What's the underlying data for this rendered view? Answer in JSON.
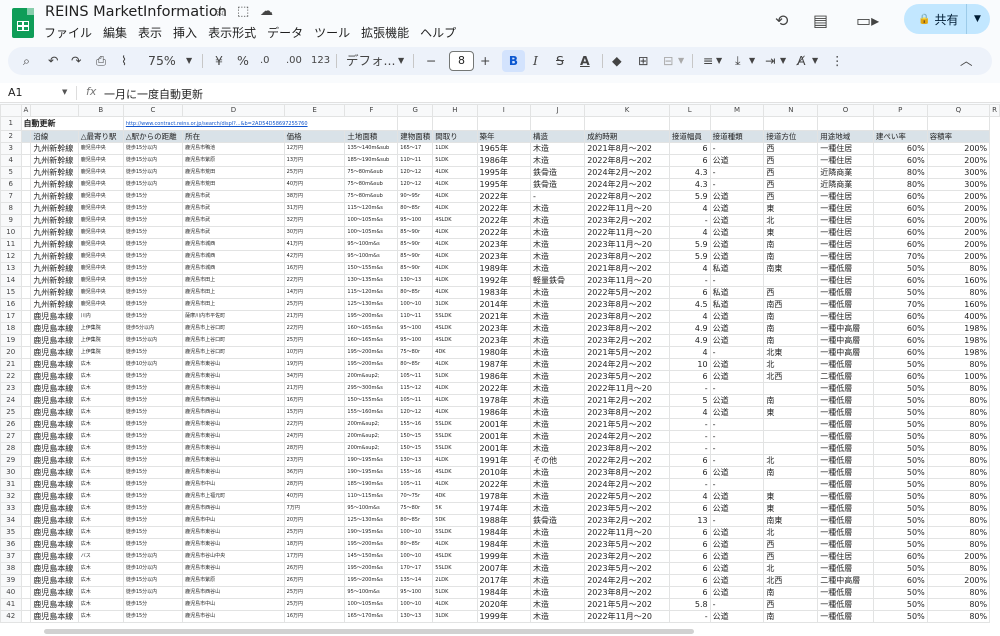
{
  "app": {
    "title": "REINS MarketInformation",
    "share_label": "共有"
  },
  "menu": [
    "ファイル",
    "編集",
    "表示",
    "挿入",
    "表示形式",
    "データ",
    "ツール",
    "拡張機能",
    "ヘルプ"
  ],
  "toolbar": {
    "zoom": "75%",
    "currency": "¥",
    "percent": "%",
    "dec_decrease": ".0",
    "dec_increase": ".00",
    "number_format": "123",
    "font": "デフォ...",
    "font_size": "8"
  },
  "formula_bar": {
    "cell": "A1",
    "fx": "fx",
    "content": "一月に一度自動更新"
  },
  "columns": [
    "",
    "A",
    "B",
    "C",
    "D",
    "E",
    "F",
    "G",
    "H",
    "I",
    "J",
    "K",
    "L",
    "M",
    "N",
    "O",
    "P",
    "Q",
    "R"
  ],
  "row1": {
    "a": "自動更新",
    "url": "http://www.contract.reins.or.jp/search/displ?...&b=2AD54D58697255760"
  },
  "headers": [
    "",
    "沿線",
    "△最寄り駅",
    "△駅からの距離",
    "所在",
    "価格",
    "土地面積",
    "建物面積",
    "間取り",
    "築年",
    "構造",
    "成約時期",
    "接道幅員",
    "接道種類",
    "接道方位",
    "用途地域",
    "建ぺい率",
    "容積率"
  ],
  "rows": [
    [
      "九州新幹線",
      "鹿児島中央",
      "徒歩15分以内",
      "鹿児島市鴨池",
      "12万円",
      "135〜140m&sub",
      "165〜17",
      "1LDK",
      "1965年",
      "木造",
      "2021年8月〜202",
      "6",
      "-",
      "西",
      "一種住居",
      "60%",
      "200%"
    ],
    [
      "九州新幹線",
      "鹿児島中央",
      "徒歩15分以内",
      "鹿児島市紫原",
      "13万円",
      "185〜190m&sub",
      "110〜11",
      "5LDK",
      "1986年",
      "木造",
      "2022年8月〜202",
      "6",
      "公道",
      "西",
      "一種住居",
      "60%",
      "200%"
    ],
    [
      "九州新幹線",
      "鹿児島中央",
      "徒歩15分以内",
      "鹿児島市荒田",
      "25万円",
      "75〜80m&sub",
      "120〜12",
      "4LDK",
      "1995年",
      "鉄骨造",
      "2024年2月〜202",
      "4.3",
      "-",
      "西",
      "近隣商業",
      "80%",
      "300%"
    ],
    [
      "九州新幹線",
      "鹿児島中央",
      "徒歩15分以内",
      "鹿児島市荒田",
      "40万円",
      "75〜80m&sub",
      "120〜12",
      "4LDK",
      "1995年",
      "鉄骨造",
      "2024年2月〜202",
      "4.3",
      "-",
      "西",
      "近隣商業",
      "80%",
      "300%"
    ],
    [
      "九州新幹線",
      "鹿児島中央",
      "徒歩15分",
      "鹿児島市武",
      "38万円",
      "75〜80m&sub",
      "90〜95r",
      "4LDK",
      "2022年",
      "-",
      "2022年8月〜202",
      "5.9",
      "公道",
      "西",
      "一種住居",
      "60%",
      "200%"
    ],
    [
      "九州新幹線",
      "鹿児島中央",
      "徒歩15分",
      "鹿児島市武",
      "31万円",
      "115〜120m&s",
      "80〜85r",
      "4LDK",
      "2022年",
      "木造",
      "2022年11月〜20",
      "4",
      "公道",
      "東",
      "一種住居",
      "60%",
      "200%"
    ],
    [
      "九州新幹線",
      "鹿児島中央",
      "徒歩15分",
      "鹿児島市武",
      "32万円",
      "100〜105m&s",
      "95〜100",
      "4SLDK",
      "2022年",
      "木造",
      "2023年2月〜202",
      "-",
      "公道",
      "北",
      "一種住居",
      "60%",
      "200%"
    ],
    [
      "九州新幹線",
      "鹿児島中央",
      "徒歩15分",
      "鹿児島市武",
      "30万円",
      "100〜105m&s",
      "85〜90r",
      "4LDK",
      "2022年",
      "木造",
      "2022年11月〜20",
      "4",
      "公道",
      "東",
      "一種住居",
      "60%",
      "200%"
    ],
    [
      "九州新幹線",
      "鹿児島中央",
      "徒歩15分",
      "鹿児島市城西",
      "41万円",
      "95〜100m&s",
      "85〜90r",
      "4LDK",
      "2023年",
      "木造",
      "2023年11月〜20",
      "5.9",
      "公道",
      "南",
      "一種住居",
      "60%",
      "200%"
    ],
    [
      "九州新幹線",
      "鹿児島中央",
      "徒歩15分",
      "鹿児島市城西",
      "42万円",
      "95〜100m&s",
      "85〜90r",
      "4LDK",
      "2023年",
      "木造",
      "2023年8月〜202",
      "5.9",
      "公道",
      "南",
      "一種住居",
      "70%",
      "200%"
    ],
    [
      "九州新幹線",
      "鹿児島中央",
      "徒歩15分",
      "鹿児島市城西",
      "16万円",
      "150〜155m&s",
      "85〜90r",
      "4LDK",
      "1989年",
      "木造",
      "2021年8月〜202",
      "4",
      "私道",
      "南東",
      "一種低層",
      "50%",
      "80%"
    ],
    [
      "九州新幹線",
      "鹿児島中央",
      "徒歩15分",
      "鹿児島市田上",
      "22万円",
      "130〜135m&s",
      "130〜13",
      "4LDK",
      "1992年",
      "軽量鉄骨",
      "2023年11月〜20",
      "-",
      "-",
      "",
      "一種住居",
      "60%",
      "160%"
    ],
    [
      "九州新幹線",
      "鹿児島中央",
      "徒歩15分",
      "鹿児島市田上",
      "14万円",
      "115〜120m&s",
      "80〜85r",
      "4LDK",
      "1983年",
      "木造",
      "2022年5月〜202",
      "6",
      "私道",
      "西",
      "一種低層",
      "50%",
      "80%"
    ],
    [
      "九州新幹線",
      "鹿児島中央",
      "徒歩15分",
      "鹿児島市田上",
      "25万円",
      "125〜130m&s",
      "100〜10",
      "3LDK",
      "2014年",
      "木造",
      "2023年8月〜202",
      "4.5",
      "私道",
      "南西",
      "一種低層",
      "70%",
      "160%"
    ],
    [
      "鹿児島本線",
      "川内",
      "徒歩15分",
      "薩摩川内市平佐町",
      "21万円",
      "195〜200m&s",
      "110〜11",
      "5SLDK",
      "2021年",
      "木造",
      "2023年8月〜202",
      "4",
      "公道",
      "南",
      "一種住居",
      "60%",
      "400%"
    ],
    [
      "鹿児島本線",
      "上伊集院",
      "徒歩5分以内",
      "鹿児島市上谷口町",
      "22万円",
      "160〜165m&s",
      "95〜100",
      "4SLDK",
      "2023年",
      "木造",
      "2023年8月〜202",
      "4.9",
      "公道",
      "南",
      "一種中高層",
      "60%",
      "198%"
    ],
    [
      "鹿児島本線",
      "上伊集院",
      "徒歩15分以内",
      "鹿児島市上谷口町",
      "25万円",
      "160〜165m&s",
      "95〜100",
      "4SLDK",
      "2023年",
      "木造",
      "2023年2月〜202",
      "4.9",
      "公道",
      "南",
      "一種中高層",
      "60%",
      "198%"
    ],
    [
      "鹿児島本線",
      "上伊集院",
      "徒歩15分",
      "鹿児島市上谷口町",
      "10万円",
      "195〜200m&s",
      "75〜80r",
      "4DK",
      "1980年",
      "木造",
      "2021年5月〜202",
      "4",
      "-",
      "北東",
      "一種中高層",
      "60%",
      "198%"
    ],
    [
      "鹿児島本線",
      "広木",
      "徒歩10分以内",
      "鹿児島市東谷山",
      "19万円",
      "195〜200m&s",
      "80〜85r",
      "4LDK",
      "1987年",
      "木造",
      "2024年2月〜202",
      "10",
      "公道",
      "北",
      "一種低層",
      "50%",
      "80%"
    ],
    [
      "鹿児島本線",
      "広木",
      "徒歩15分",
      "鹿児島市東谷山",
      "34万円",
      "200m&sup2;",
      "105〜11",
      "5LDK",
      "1986年",
      "木造",
      "2023年5月〜202",
      "6",
      "公道",
      "北西",
      "二種低層",
      "60%",
      "100%"
    ],
    [
      "鹿児島本線",
      "広木",
      "徒歩15分",
      "鹿児島市東谷山",
      "21万円",
      "295〜300m&s",
      "115〜12",
      "4LDK",
      "2022年",
      "木造",
      "2022年11月〜20",
      "-",
      "-",
      "",
      "一種低層",
      "50%",
      "80%"
    ],
    [
      "鹿児島本線",
      "広木",
      "徒歩15分",
      "鹿児島市西谷山",
      "16万円",
      "150〜155m&s",
      "105〜11",
      "4LDK",
      "1978年",
      "木造",
      "2021年2月〜202",
      "5",
      "公道",
      "南",
      "一種低層",
      "50%",
      "80%"
    ],
    [
      "鹿児島本線",
      "広木",
      "徒歩15分",
      "鹿児島市西谷山",
      "15万円",
      "155〜160m&s",
      "120〜12",
      "4LDK",
      "1986年",
      "木造",
      "2023年8月〜202",
      "4",
      "公道",
      "東",
      "一種低層",
      "50%",
      "80%"
    ],
    [
      "鹿児島本線",
      "広木",
      "徒歩15分",
      "鹿児島市東谷山",
      "22万円",
      "200m&sup2;",
      "155〜16",
      "5SLDK",
      "2001年",
      "木造",
      "2021年5月〜202",
      "-",
      "-",
      "",
      "一種低層",
      "50%",
      "80%"
    ],
    [
      "鹿児島本線",
      "広木",
      "徒歩15分",
      "鹿児島市東谷山",
      "24万円",
      "200m&sup2;",
      "150〜15",
      "5SLDK",
      "2001年",
      "木造",
      "2024年2月〜202",
      "-",
      "-",
      "",
      "一種低層",
      "50%",
      "80%"
    ],
    [
      "鹿児島本線",
      "広木",
      "徒歩15分",
      "鹿児島市東谷山",
      "28万円",
      "200m&sup2;",
      "150〜15",
      "5SLDK",
      "2001年",
      "木造",
      "2023年8月〜202",
      "-",
      "-",
      "",
      "一種低層",
      "50%",
      "80%"
    ],
    [
      "鹿児島本線",
      "広木",
      "徒歩15分",
      "鹿児島市東谷山",
      "23万円",
      "190〜195m&s",
      "130〜13",
      "4LDK",
      "1991年",
      "その他",
      "2022年2月〜202",
      "6",
      "-",
      "北",
      "一種低層",
      "50%",
      "80%"
    ],
    [
      "鹿児島本線",
      "広木",
      "徒歩15分",
      "鹿児島市東谷山",
      "36万円",
      "190〜195m&s",
      "155〜16",
      "4SLDK",
      "2010年",
      "木造",
      "2023年8月〜202",
      "6",
      "公道",
      "南",
      "一種低層",
      "50%",
      "80%"
    ],
    [
      "鹿児島本線",
      "広木",
      "徒歩15分",
      "鹿児島市中山",
      "28万円",
      "185〜190m&s",
      "105〜11",
      "4LDK",
      "2022年",
      "木造",
      "2024年2月〜202",
      "-",
      "-",
      "",
      "一種低層",
      "50%",
      "80%"
    ],
    [
      "鹿児島本線",
      "広木",
      "徒歩15分",
      "鹿児島市上福元町",
      "40万円",
      "110〜115m&s",
      "70〜75r",
      "4DK",
      "1978年",
      "木造",
      "2022年5月〜202",
      "4",
      "公道",
      "東",
      "一種低層",
      "50%",
      "80%"
    ],
    [
      "鹿児島本線",
      "広木",
      "徒歩15分",
      "鹿児島市西谷山",
      "7万円",
      "95〜100m&s",
      "75〜80r",
      "5K",
      "1974年",
      "木造",
      "2023年5月〜202",
      "6",
      "公道",
      "東",
      "一種低層",
      "50%",
      "80%"
    ],
    [
      "鹿児島本線",
      "広木",
      "徒歩15分",
      "鹿児島市中山",
      "20万円",
      "125〜130m&s",
      "80〜85r",
      "5DK",
      "1988年",
      "鉄骨造",
      "2023年2月〜202",
      "13",
      "-",
      "南東",
      "一種低層",
      "50%",
      "80%"
    ],
    [
      "鹿児島本線",
      "広木",
      "徒歩15分",
      "鹿児島市東谷山",
      "25万円",
      "190〜195m&s",
      "100〜10",
      "5SLDK",
      "1984年",
      "木造",
      "2022年11月〜20",
      "6",
      "公道",
      "北",
      "一種低層",
      "50%",
      "80%"
    ],
    [
      "鹿児島本線",
      "広木",
      "徒歩15分",
      "鹿児島市東谷山",
      "18万円",
      "195〜200m&s",
      "80〜85r",
      "4LDK",
      "1984年",
      "木造",
      "2023年5月〜202",
      "6",
      "公道",
      "西",
      "一種低層",
      "50%",
      "80%"
    ],
    [
      "鹿児島本線",
      "バス",
      "徒歩15分以内",
      "鹿児島市谷山中央",
      "17万円",
      "145〜150m&s",
      "100〜10",
      "4SLDK",
      "1999年",
      "木造",
      "2023年2月〜202",
      "6",
      "公道",
      "西",
      "一種住居",
      "60%",
      "200%"
    ],
    [
      "鹿児島本線",
      "広木",
      "徒歩10分以内",
      "鹿児島市東谷山",
      "26万円",
      "195〜200m&s",
      "170〜17",
      "5SLDK",
      "2007年",
      "木造",
      "2023年5月〜202",
      "6",
      "公道",
      "北",
      "一種低層",
      "50%",
      "80%"
    ],
    [
      "鹿児島本線",
      "広木",
      "徒歩15分以内",
      "鹿児島市紫原",
      "26万円",
      "195〜200m&s",
      "135〜14",
      "2LDK",
      "2017年",
      "木造",
      "2024年2月〜202",
      "6",
      "公道",
      "北西",
      "二種中高層",
      "60%",
      "200%"
    ],
    [
      "鹿児島本線",
      "広木",
      "徒歩15分以内",
      "鹿児島市西谷山",
      "25万円",
      "95〜100m&s",
      "95〜100",
      "5LDK",
      "1984年",
      "木造",
      "2023年8月〜202",
      "6",
      "公道",
      "南",
      "一種低層",
      "50%",
      "80%"
    ],
    [
      "鹿児島本線",
      "広木",
      "徒歩15分",
      "鹿児島市中山",
      "25万円",
      "100〜105m&s",
      "100〜10",
      "4LDK",
      "2020年",
      "木造",
      "2021年5月〜202",
      "5.8",
      "-",
      "西",
      "一種低層",
      "50%",
      "80%"
    ],
    [
      "鹿児島本線",
      "広木",
      "徒歩15分",
      "鹿児島市谷山",
      "16万円",
      "165〜170m&s",
      "130〜13",
      "3LDK",
      "1999年",
      "木造",
      "2022年11月〜20",
      "-",
      "公道",
      "南",
      "一種低層",
      "50%",
      "80%"
    ]
  ]
}
